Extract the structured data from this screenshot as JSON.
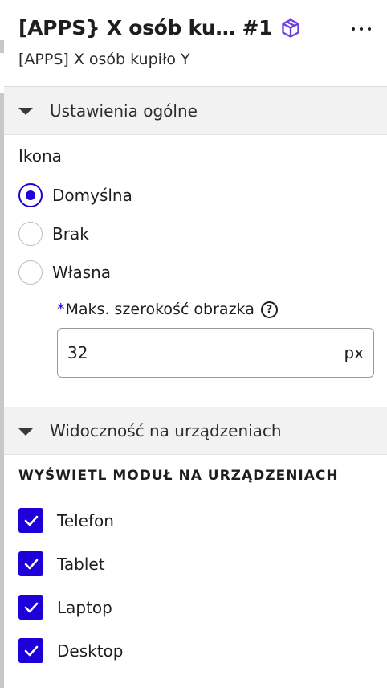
{
  "header": {
    "title": "[APPS} X osób ku… #1",
    "subtitle": "[APPS] X osób kupiło Y",
    "module_icon": "cube-icon",
    "more_icon": "more-horizontal-icon"
  },
  "colors": {
    "accent": "#1e00d8",
    "module_icon": "#6b3fe0",
    "section_bg": "#f2f2f2"
  },
  "sections": [
    {
      "label": "Ustawienia ogólne",
      "icon_group": {
        "label": "Ikona",
        "options": [
          {
            "label": "Domyślna",
            "checked": true
          },
          {
            "label": "Brak",
            "checked": false
          },
          {
            "label": "Własna",
            "checked": false
          }
        ]
      },
      "max_width_field": {
        "required_mark": "*",
        "label": "Maks. szerokość obrazka",
        "help_icon": "question-circle-icon",
        "value": "32",
        "unit": "px"
      }
    },
    {
      "label": "Widoczność na urządzeniach",
      "devices_label": "WYŚWIETL MODUŁ NA URZĄDZENIACH",
      "devices": [
        {
          "label": "Telefon",
          "checked": true
        },
        {
          "label": "Tablet",
          "checked": true
        },
        {
          "label": "Laptop",
          "checked": true
        },
        {
          "label": "Desktop",
          "checked": true
        }
      ]
    }
  ]
}
